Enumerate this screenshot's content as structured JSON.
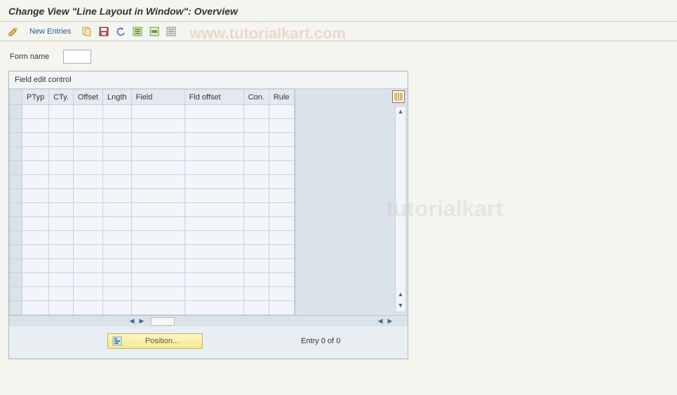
{
  "title": "Change View \"Line Layout in Window\": Overview",
  "toolbar": {
    "new_entries": "New Entries"
  },
  "form": {
    "label": "Form name",
    "value": ""
  },
  "panel": {
    "header": "Field edit control"
  },
  "columns": {
    "ptyp": "PTyp",
    "cty": "CTy.",
    "offset": "Offset",
    "length": "Lngth",
    "field": "Field",
    "fld_offset": "Fld offset",
    "con": "Con.",
    "rule": "Rule"
  },
  "footer": {
    "position": "Position...",
    "entry": "Entry 0 of 0"
  },
  "watermark1": "www.tutorialkart.com",
  "watermark2": "tutorialkart"
}
